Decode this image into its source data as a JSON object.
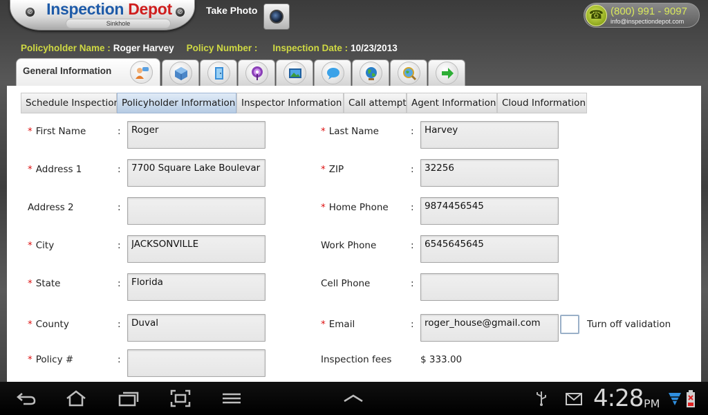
{
  "header": {
    "logo_word1": "Inspection",
    "logo_word2": "Depot",
    "logo_sub": "Sinkhole",
    "take_photo_label": "Take Photo",
    "phone_number": "(800) 991 - 9097",
    "email": "info@inspectiondepot.com"
  },
  "info": {
    "policyholder_label": "Policyholder Name :",
    "policyholder_value": "Roger Harvey",
    "policy_number_label": "Policy Number :",
    "policy_number_value": "",
    "inspection_date_label": "Inspection Date :",
    "inspection_date_value": "10/23/2013"
  },
  "main_tabs": {
    "active_label": "General Information"
  },
  "sub_tabs": [
    "Schedule Inspection",
    "Policyholder Information",
    "Inspector Information",
    "Call attempt",
    "Agent Information",
    "Cloud Information"
  ],
  "form": {
    "first_name_label": "First Name",
    "first_name_value": "Roger",
    "last_name_label": "Last Name",
    "last_name_value": "Harvey",
    "address1_label": "Address 1",
    "address1_value": "7700 Square Lake Boulevar",
    "zip_label": "ZIP",
    "zip_value": "32256",
    "address2_label": "Address 2",
    "address2_value": "",
    "home_phone_label": "Home Phone",
    "home_phone_value": "9874456545",
    "city_label": "City",
    "city_value": "JACKSONVILLE",
    "work_phone_label": "Work Phone",
    "work_phone_value": "6545645645",
    "state_label": "State",
    "state_value": "Florida",
    "cell_phone_label": "Cell Phone",
    "cell_phone_value": "",
    "county_label": "County",
    "county_value": "Duval",
    "email_label": "Email",
    "email_value": "roger_house@gmail.com",
    "turn_off_validation_label": "Turn off validation",
    "policy_no_label": "Policy #",
    "policy_no_value": "",
    "inspection_fees_label": "Inspection fees",
    "inspection_fees_value": "$ 333.00",
    "required_mark": "*",
    "colon": ":"
  },
  "status": {
    "time": "4:28",
    "ampm": "PM"
  },
  "colors": {
    "label_yellow": "#cfd943",
    "required_red": "#dd1111",
    "active_subtab": "#b6cbe3",
    "logo_blue": "#1d5aa8",
    "logo_red": "#cf1e1e"
  }
}
